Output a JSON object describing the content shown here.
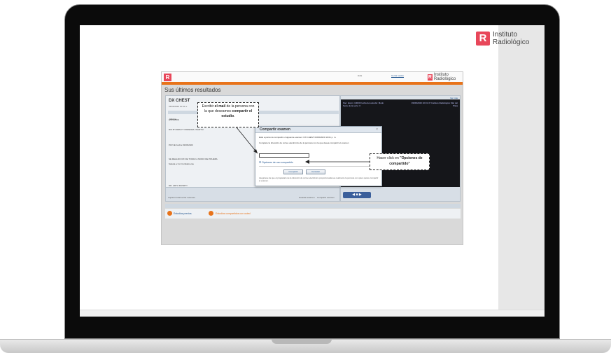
{
  "brand": {
    "logo_letter": "R",
    "line1": "Instituto",
    "line2": "Radiológico",
    "color": "#e8475a"
  },
  "app": {
    "logo_letter": "R",
    "header_user": "Hola",
    "header_close": "Cerrar sesión",
    "header_brand": "Instituto Radiológico",
    "orange_bar_label": "Inicio",
    "page_title": "Sus últimos resultados",
    "study": {
      "title": "DX CHEST",
      "date": "03/06/2020 10:01 a.",
      "tab": "Informe",
      "lines": [
        "ESTADIOS",
        "RIO BY-MRGYT PAREDES. WARYM",
        "PAYCE Fecha 03/06/2020",
        "SE REALIZO RX DE TORAX A MODO DE PRUEBA",
        "Saluda a Ud. Cordialmente",
        "DR. ARTU RUSRTY"
      ]
    },
    "left_footer": [
      "Imprimir informe",
      "Ver resumen",
      "Guardar examen",
      "Compartir examen"
    ],
    "viewer": {
      "top_link": "Ver más",
      "meta_left": "Pac: Exam: 10000 Fecha del estudio: Modo Serie de la serie: 0",
      "meta_right": "03/06/2020 10:01:47 Instituto Radiológico Mar del Plata",
      "controls": "◀ ■ ▶"
    },
    "sub_bar": "Sus últimos resultados",
    "links": [
      "Estudios previos",
      "Estudios compartidos con usted"
    ]
  },
  "modal": {
    "title": "Compartir examen",
    "close": "×",
    "line1": "Está a punto de compartir el siguiente examen: DX CHEST 03/06/2020 10:01 p. m.",
    "line2": "Complete la dirección de correo electrónico de la persona con la que desea compartir el examen",
    "email_value": "",
    "options_link": "Opciones de uso compartido",
    "btn_share": "Compartir",
    "btn_cancel": "Cancelar",
    "footer": "Asegúrese de que el propietario de la dirección de correo electrónico proporcionada sea realmente la persona con quien quiere compartir el examen."
  },
  "callouts": {
    "c1_pre": "Escribir ",
    "c1_bold1": "el mail",
    "c1_mid": " de la persona con la que deseamos ",
    "c1_bold2": "compartir el estudio",
    "c1_post": ".",
    "c2_pre": "Hacer click en ",
    "c2_bold": "\"Opciones de compartido\""
  }
}
